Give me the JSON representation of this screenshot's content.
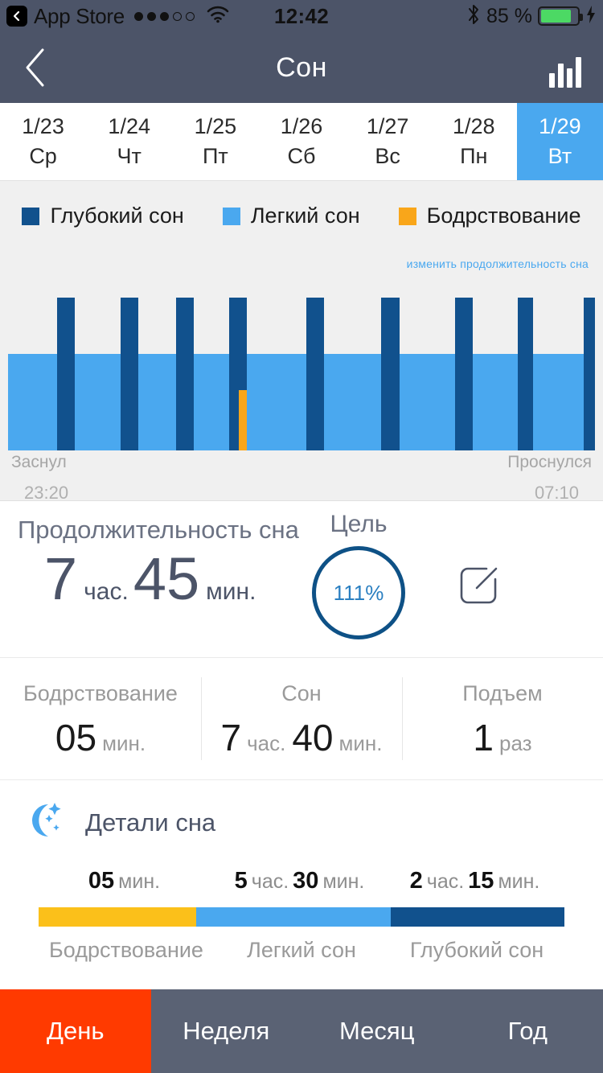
{
  "statusbar": {
    "back_app": "App Store",
    "signal_dots": [
      true,
      true,
      true,
      false,
      false
    ],
    "wifi_icon": "wifi-icon",
    "time": "12:42",
    "bluetooth_icon": "bluetooth-icon",
    "battery_text": "85 %",
    "battery_level": 85,
    "charging_icon": "lightning-bolt-icon"
  },
  "navbar": {
    "back_icon": "chevron-left-icon",
    "title": "Сон",
    "chart_icon": "bar-chart-icon"
  },
  "dates": [
    {
      "date": "1/23",
      "day": "Ср",
      "active": false
    },
    {
      "date": "1/24",
      "day": "Чт",
      "active": false
    },
    {
      "date": "1/25",
      "day": "Пт",
      "active": false
    },
    {
      "date": "1/26",
      "day": "Сб",
      "active": false
    },
    {
      "date": "1/27",
      "day": "Вс",
      "active": false
    },
    {
      "date": "1/28",
      "day": "Пн",
      "active": false
    },
    {
      "date": "1/29",
      "day": "Вт",
      "active": true
    }
  ],
  "legend": [
    {
      "label": "Глубокий сон",
      "color": "#11518d"
    },
    {
      "label": "Легкий сон",
      "color": "#4aa8ef"
    },
    {
      "label": "Бодрствование",
      "color": "#f9a61a"
    }
  ],
  "chart_panel": {
    "edit_duration_link": "изменить продолжительность сна",
    "fell_asleep_label": "Заснул",
    "woke_up_label": "Проснулся",
    "fell_asleep_time": "23:20",
    "woke_up_time": "07:10"
  },
  "chart_data": {
    "type": "bar",
    "title": "Фазы сна за ночь",
    "xlabel": "",
    "ylabel": "",
    "x_range": [
      "23:20",
      "07:10"
    ],
    "legend_position": "top",
    "grid": false,
    "colors": {
      "deep": "#11518d",
      "light": "#4aa8ef",
      "awake": "#f9a61a"
    },
    "series": [
      {
        "name": "Легкий сон",
        "color": "#4aa8ef",
        "segments": [
          {
            "x": 10,
            "w": 61,
            "h": 120
          },
          {
            "x": 93,
            "w": 57,
            "h": 120
          },
          {
            "x": 172,
            "w": 47,
            "h": 120
          },
          {
            "x": 241,
            "w": 56,
            "h": 120
          },
          {
            "x": 307,
            "w": 74,
            "h": 120
          },
          {
            "x": 403,
            "w": 71,
            "h": 120
          },
          {
            "x": 497,
            "w": 69,
            "h": 120
          },
          {
            "x": 588,
            "w": 56,
            "h": 120
          },
          {
            "x": 663,
            "w": 63,
            "h": 120
          }
        ]
      },
      {
        "name": "Глубокий сон",
        "color": "#11518d",
        "segments": [
          {
            "x": 71,
            "w": 22,
            "h": 190
          },
          {
            "x": 150,
            "w": 22,
            "h": 190
          },
          {
            "x": 219,
            "w": 22,
            "h": 190
          },
          {
            "x": 285,
            "w": 22,
            "h": 190
          },
          {
            "x": 381,
            "w": 22,
            "h": 190
          },
          {
            "x": 474,
            "w": 23,
            "h": 190
          },
          {
            "x": 566,
            "w": 22,
            "h": 190
          },
          {
            "x": 644,
            "w": 19,
            "h": 190
          },
          {
            "x": 726,
            "w": 14,
            "h": 190
          }
        ]
      },
      {
        "name": "Бодрствование",
        "color": "#f9a61a",
        "segments": [
          {
            "x": 297,
            "w": 10,
            "h": 75
          }
        ]
      }
    ]
  },
  "duration": {
    "title": "Продолжительность сна",
    "hours": "7",
    "hours_unit": "час.",
    "minutes": "45",
    "minutes_unit": "мин.",
    "goal_title": "Цель",
    "goal_percent": "111%",
    "edit_icon": "edit-pencil-icon"
  },
  "stats": [
    {
      "label": "Бодрствование",
      "value": "05",
      "unit": "мин."
    },
    {
      "label": "Сон",
      "value1": "7",
      "unit1": "час.",
      "value2": "40",
      "unit2": "мин."
    },
    {
      "label": "Подъем",
      "value": "1",
      "unit": "раз"
    }
  ],
  "details": {
    "icon": "crescent-moon-stars-icon",
    "title": "Детали сна",
    "items": [
      {
        "label": "Бодрствование",
        "v1": "05",
        "u1": "мин.",
        "color": "#fbc01a",
        "percent": 30
      },
      {
        "label": "Легкий сон",
        "v1": "5",
        "u1": "час.",
        "v2": "30",
        "u2": "мин.",
        "color": "#4aa8ef",
        "percent": 37
      },
      {
        "label": "Глубокий сон",
        "v1": "2",
        "u1": "час.",
        "v2": "15",
        "u2": "мин.",
        "color": "#11518d",
        "percent": 33
      }
    ]
  },
  "tabs": [
    {
      "label": "День",
      "active": true
    },
    {
      "label": "Неделя",
      "active": false
    },
    {
      "label": "Месяц",
      "active": false
    },
    {
      "label": "Год",
      "active": false
    }
  ]
}
